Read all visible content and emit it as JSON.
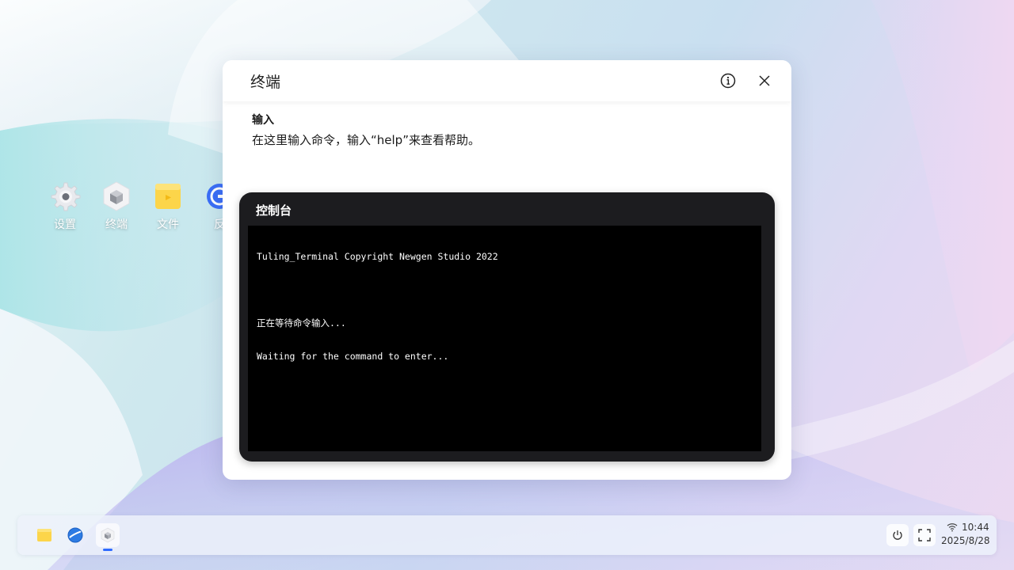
{
  "desktop": {
    "icons": [
      {
        "label": "设置",
        "icon": "gear-icon"
      },
      {
        "label": "终端",
        "icon": "cube-icon"
      },
      {
        "label": "文件",
        "icon": "folder-icon"
      },
      {
        "label": "反",
        "icon": "browser-icon"
      }
    ]
  },
  "window": {
    "title": "终端",
    "input_heading": "输入",
    "input_description": "在这里输入命令，输入“help”来查看帮助。",
    "console": {
      "title": "控制台",
      "lines": [
        "Tuling_Terminal Copyright Newgen Studio 2022",
        "",
        "正在等待命令输入...",
        "Waiting for the command to enter..."
      ]
    }
  },
  "taskbar": {
    "apps": [
      {
        "name": "files",
        "icon": "folder-icon"
      },
      {
        "name": "browser",
        "icon": "browser-icon"
      },
      {
        "name": "terminal",
        "icon": "cube-icon",
        "active": true
      }
    ],
    "time": "10:44",
    "date": "2025/8/28"
  },
  "colors": {
    "accent": "#2f6bff",
    "console_bg": "#1c1c1f",
    "screen_bg": "#000000"
  }
}
